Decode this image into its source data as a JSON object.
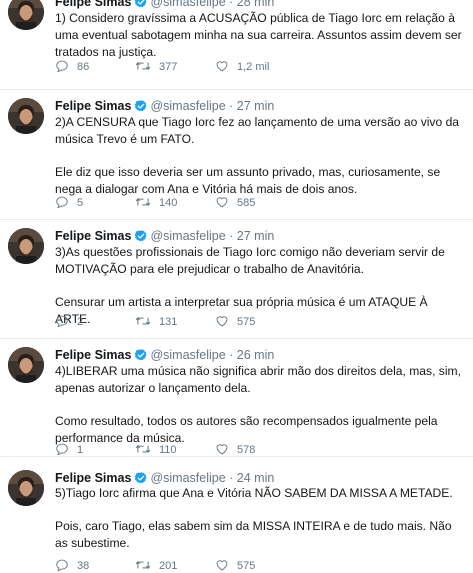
{
  "tweets": [
    {
      "name": "Felipe Simas",
      "handle": "@simasfelipe",
      "sep": "·",
      "time": "28 min",
      "paragraphs": [
        "1) Considero gravíssima a ACUSAÇÃO pública de Tiago Iorc em relação à uma eventual sabotagem minha na sua carreira. Assuntos assim devem ser tratados na justiça."
      ],
      "replies": "86",
      "retweets": "377",
      "likes": "1,2 mil"
    },
    {
      "name": "Felipe Simas",
      "handle": "@simasfelipe",
      "sep": "·",
      "time": "27 min",
      "paragraphs": [
        "2)A CENSURA que Tiago Iorc fez ao lançamento de uma versão ao vivo da música Trevo é um FATO.",
        "Ele diz que isso deveria ser um assunto privado, mas, curiosamente, se nega a dialogar com Ana e Vitória há mais de dois anos."
      ],
      "replies": "5",
      "retweets": "140",
      "likes": "585"
    },
    {
      "name": "Felipe Simas",
      "handle": "@simasfelipe",
      "sep": "·",
      "time": "27 min",
      "paragraphs": [
        "3)As questões profissionais de Tiago Iorc comigo não deveriam servir de MOTIVAÇÃO para ele prejudicar o trabalho de Anavitória.",
        "Censurar um artista a interpretar sua própria música é um ATAQUE À ARTE."
      ],
      "replies": "2",
      "retweets": "131",
      "likes": "575"
    },
    {
      "name": "Felipe Simas",
      "handle": "@simasfelipe",
      "sep": "·",
      "time": "26 min",
      "paragraphs": [
        "4)LIBERAR uma música não significa abrir mão dos direitos dela, mas, sim, apenas autorizar o lançamento dela.",
        "Como resultado, todos os autores são recompensados igualmente pela performance da música."
      ],
      "replies": "1",
      "retweets": "110",
      "likes": "578"
    },
    {
      "name": "Felipe Simas",
      "handle": "@simasfelipe",
      "sep": "·",
      "time": "24 min",
      "paragraphs": [
        "5)Tiago Iorc afirma que Ana e Vitória NÃO SABEM DA MISSA A METADE.",
        "Pois, caro Tiago, elas sabem sim da MISSA INTEIRA e de tudo mais. Não as subestime."
      ],
      "replies": "38",
      "retweets": "201",
      "likes": "575"
    }
  ],
  "icons": {
    "verified": "verified-badge-icon",
    "reply": "reply-icon",
    "retweet": "retweet-icon",
    "like": "heart-icon"
  },
  "colors": {
    "verified": "#1da1f2",
    "text": "#14171a",
    "muted": "#657786",
    "divider": "#e6ecf0"
  }
}
